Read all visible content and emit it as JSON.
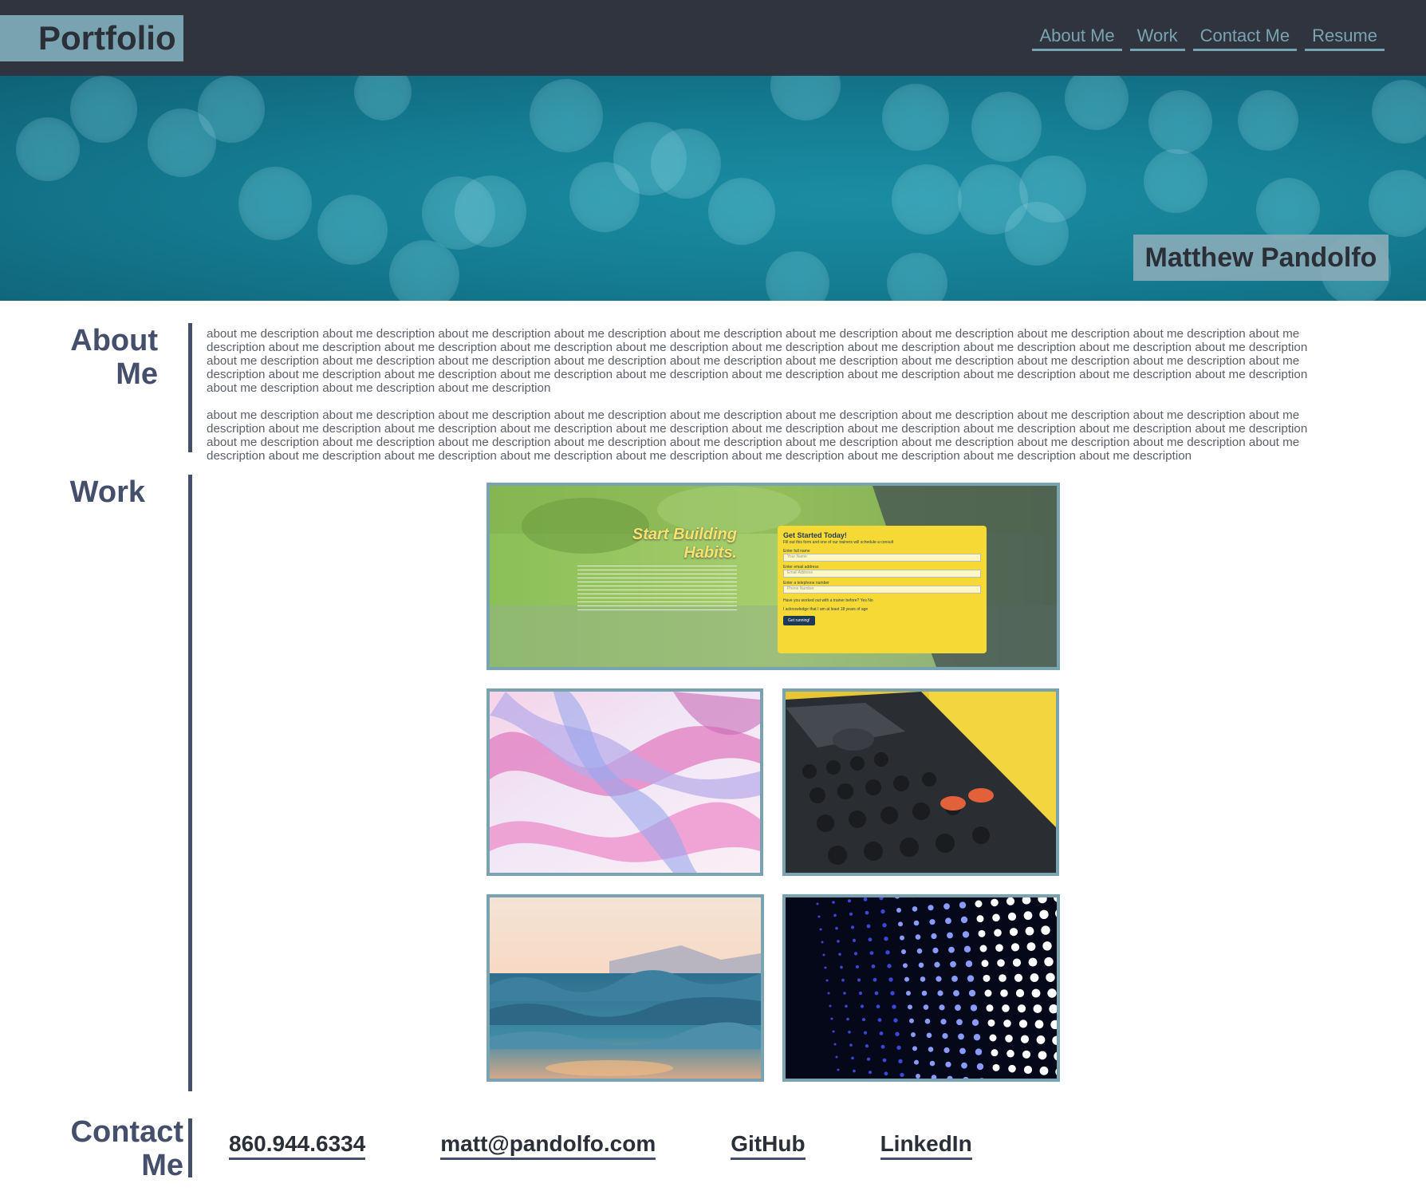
{
  "header": {
    "brand": "Portfolio",
    "nav": [
      "About Me",
      "Work",
      "Contact Me",
      "Resume"
    ]
  },
  "hero": {
    "name": "Matthew Pandolfo"
  },
  "about": {
    "title": "About Me",
    "paragraphs": [
      "about me description about me description about me description about me description about me description about me description about me description about me description about me description about me description about me description about me description about me description about me description about me description about me description about me description about me description about me description about me description about me description about me description about me description about me description about me description about me description about me description about me description about me description about me description about me description about me description about me description about me description about me description about me description about me description about me description about me description about me description about me description",
      "about me description about me description about me description about me description about me description about me description about me description about me description about me description about me description about me description about me description about me description about me description about me description about me description about me description about me description about me description about me description about me description about me description about me description about me description about me description about me description about me description about me description about me description about me description about me description about me description about me description about me description about me description about me description about me description"
    ]
  },
  "work": {
    "title": "Work",
    "featured": {
      "headline": "Start Building Habits.",
      "form_title": "Get Started Today!",
      "form_sub": "Fill out this form and one of our trainers will schedule a consult",
      "fields": [
        {
          "label": "Enter full name",
          "placeholder": "Your Name"
        },
        {
          "label": "Enter email address",
          "placeholder": "Email Address"
        },
        {
          "label": "Enter a telephone number",
          "placeholder": "Phone Number"
        }
      ],
      "question": "Have you worked out with a trainer before?",
      "yes": "Yes",
      "no": "No",
      "ack": "I acknowledge that I am at least 18 years of age",
      "submit": "Get running!"
    }
  },
  "contact": {
    "title": "Contact Me",
    "links": [
      "860.944.6334",
      "matt@pandolfo.com",
      "GitHub",
      "LinkedIn"
    ]
  },
  "colors": {
    "header_bg": "#30343e",
    "accent": "#7aa3b1",
    "heading": "#454f6b",
    "hero": "#157e94"
  }
}
